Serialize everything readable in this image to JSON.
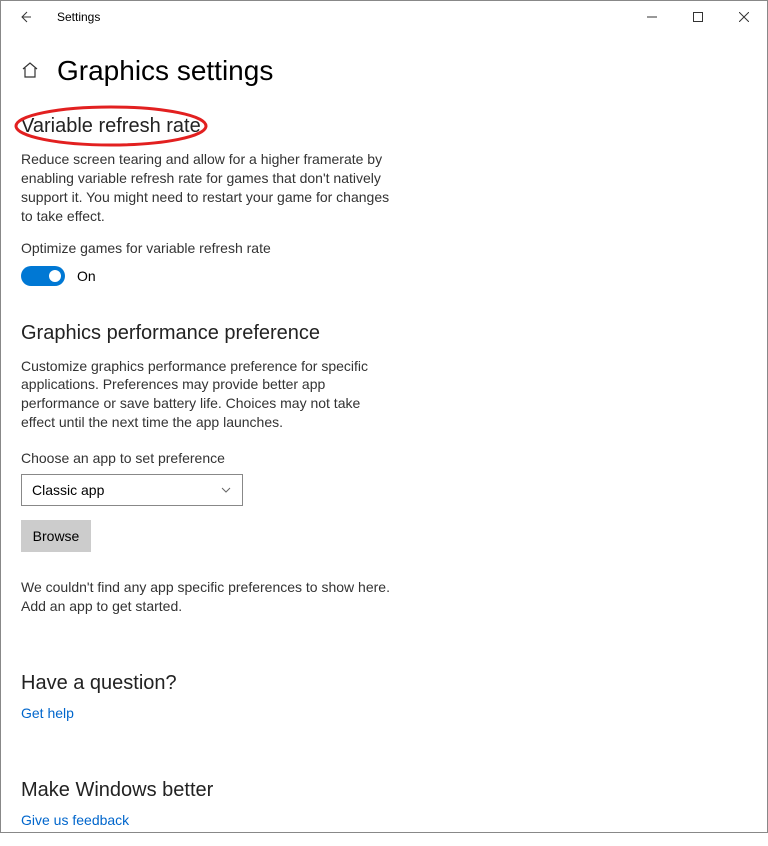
{
  "window": {
    "title": "Settings"
  },
  "page": {
    "title": "Graphics settings"
  },
  "sections": {
    "vrr": {
      "heading": "Variable refresh rate",
      "description": "Reduce screen tearing and allow for a higher framerate by enabling variable refresh rate for games that don't natively support it. You might need to restart your game for changes to take effect.",
      "toggle_label": "Optimize games for variable refresh rate",
      "toggle_state": "On"
    },
    "perf": {
      "heading": "Graphics performance preference",
      "description": "Customize graphics performance preference for specific applications. Preferences may provide better app performance or save battery life. Choices may not take effect until the next time the app launches.",
      "choose_label": "Choose an app to set preference",
      "select_value": "Classic app",
      "browse_label": "Browse",
      "empty_msg": "We couldn't find any app specific preferences to show here. Add an app to get started."
    },
    "help": {
      "heading": "Have a question?",
      "link": "Get help"
    },
    "feedback": {
      "heading": "Make Windows better",
      "link": "Give us feedback"
    }
  }
}
